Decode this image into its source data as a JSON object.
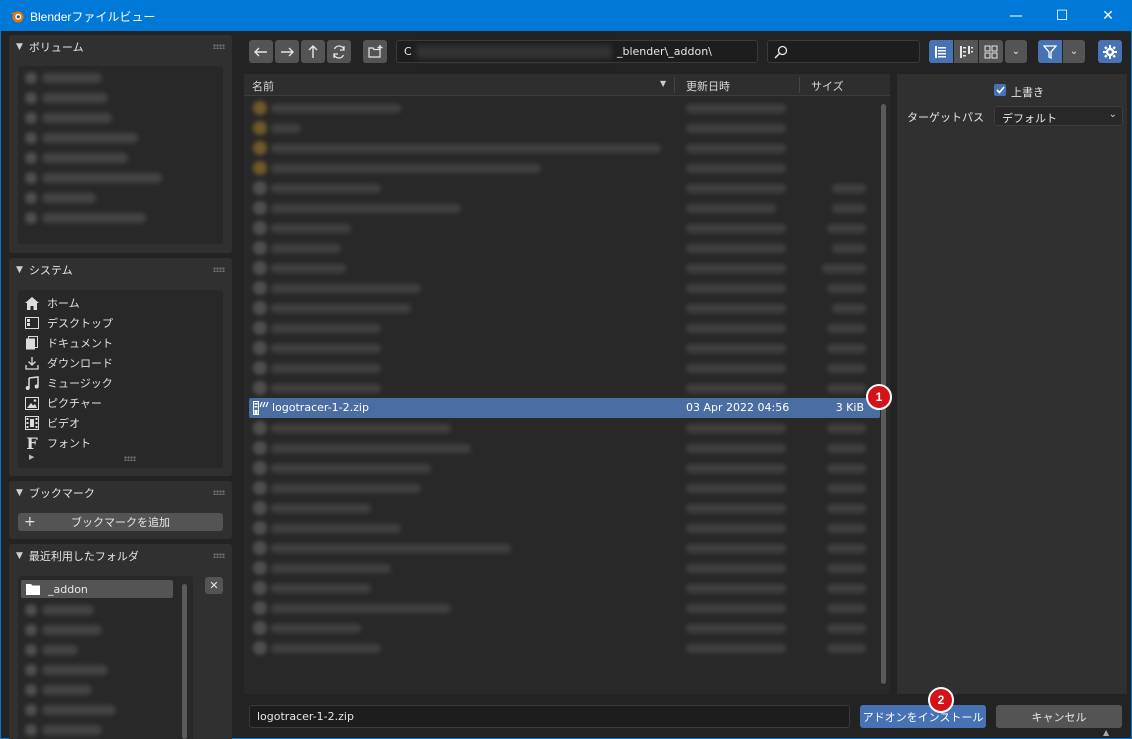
{
  "window": {
    "title": "Blenderファイルビュー",
    "minimize": "—",
    "maximize": "☐",
    "close": "✕"
  },
  "sidebar": {
    "volumes": {
      "title": "ボリューム"
    },
    "system": {
      "title": "システム",
      "items": [
        {
          "label": "ホーム",
          "icon": "home-icon"
        },
        {
          "label": "デスクトップ",
          "icon": "desktop-icon"
        },
        {
          "label": "ドキュメント",
          "icon": "documents-icon"
        },
        {
          "label": "ダウンロード",
          "icon": "download-icon"
        },
        {
          "label": "ミュージック",
          "icon": "music-icon"
        },
        {
          "label": "ピクチャー",
          "icon": "pictures-icon"
        },
        {
          "label": "ビデオ",
          "icon": "video-icon"
        },
        {
          "label": "フォント",
          "icon": "font-icon"
        }
      ]
    },
    "bookmarks": {
      "title": "ブックマーク",
      "add_label": "ブックマークを追加"
    },
    "recent": {
      "title": "最近利用したフォルダ",
      "active_item": "_addon"
    }
  },
  "toolbar": {
    "path_prefix": "C",
    "path_suffix": "_blender\\_addon\\",
    "search_placeholder": ""
  },
  "file_list": {
    "columns": {
      "name": "名前",
      "date": "更新日時",
      "size": "サイズ"
    },
    "selected": {
      "name": "logotracer-1-2.zip",
      "date": "03 Apr 2022 04:56",
      "size": "3 KiB"
    }
  },
  "options": {
    "overwrite_label": "上書き",
    "target_path_label": "ターゲットパス",
    "target_path_value": "デフォルト"
  },
  "bottom": {
    "filename": "logotracer-1-2.zip",
    "install_label": "アドオンをインストール",
    "cancel_label": "キャンセル"
  },
  "annotations": {
    "badge1": "1",
    "badge2": "2"
  },
  "colors": {
    "accent": "#4772b3",
    "selected_row": "#4a6ea1",
    "titlebar": "#0078d7",
    "badge": "#d4121a"
  }
}
